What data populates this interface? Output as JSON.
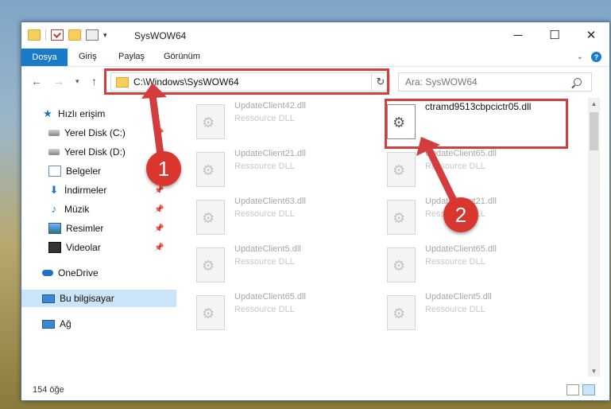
{
  "window": {
    "title": "SysWOW64"
  },
  "window_buttons": {
    "minimize": "─",
    "maximize": "☐",
    "close": "✕"
  },
  "ribbon": {
    "tabs": [
      "Dosya",
      "Giriş",
      "Paylaş",
      "Görünüm"
    ]
  },
  "address": {
    "path": "C:\\Windows\\SysWOW64",
    "search_placeholder": "Ara: SysWOW64"
  },
  "nav_pane": {
    "items": [
      {
        "label": "Hızlı erişim",
        "icon": "star-icon",
        "pinned": false
      },
      {
        "label": "Yerel Disk (C:)",
        "icon": "drive-icon",
        "pinned": true
      },
      {
        "label": "Yerel Disk (D:)",
        "icon": "drive-icon",
        "pinned": true
      },
      {
        "label": "Belgeler",
        "icon": "documents-icon",
        "pinned": true
      },
      {
        "label": "İndirmeler",
        "icon": "downloads-icon",
        "pinned": true
      },
      {
        "label": "Müzik",
        "icon": "music-icon",
        "pinned": true
      },
      {
        "label": "Resimler",
        "icon": "pictures-icon",
        "pinned": true
      },
      {
        "label": "Videolar",
        "icon": "videos-icon",
        "pinned": true
      },
      {
        "label": "OneDrive",
        "icon": "onedrive-icon",
        "pinned": false
      },
      {
        "label": "Bu bilgisayar",
        "icon": "this-pc-icon",
        "pinned": false,
        "selected": true
      },
      {
        "label": "Ağ",
        "icon": "network-icon",
        "pinned": false
      }
    ]
  },
  "files": [
    {
      "name": "UpdateClient42.dll",
      "type": "Ressource DLL"
    },
    {
      "name": "ctramd9513cbpcictr05.dll",
      "type": "",
      "highlighted": true
    },
    {
      "name": "UpdateClient21.dll",
      "type": "Ressource DLL"
    },
    {
      "name": "UpdateClient65.dll",
      "type": "Ressource DLL"
    },
    {
      "name": "UpdateClient63.dll",
      "type": "Ressource DLL"
    },
    {
      "name": "UpdateClient21.dll",
      "type": "Ressource DLL"
    },
    {
      "name": "UpdateClient5.dll",
      "type": "Ressource DLL"
    },
    {
      "name": "UpdateClient65.dll",
      "type": "Ressource DLL"
    },
    {
      "name": "UpdateClient65.dll",
      "type": "Ressource DLL"
    },
    {
      "name": "UpdateClient5.dll",
      "type": "Ressource DLL"
    }
  ],
  "status": {
    "item_count": "154 öğe"
  },
  "callouts": {
    "one": "1",
    "two": "2"
  },
  "colors": {
    "accent": "#1979ca",
    "annotation": "#d43d3d",
    "selection": "#cce4f7"
  }
}
